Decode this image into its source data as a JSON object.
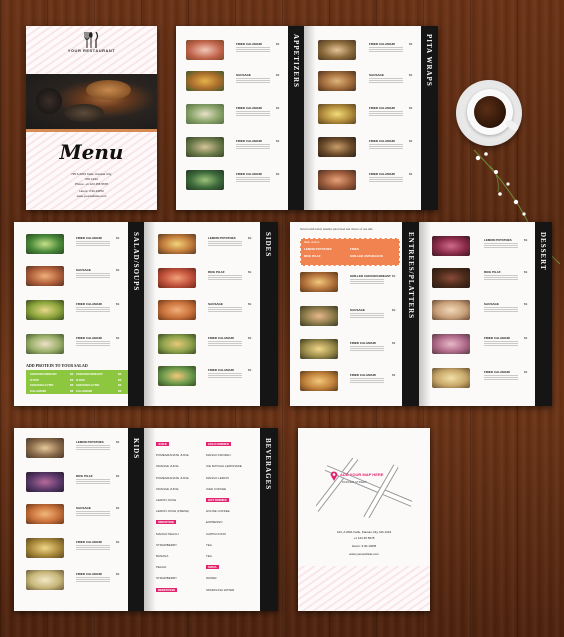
{
  "cover": {
    "brand": "YOUR RESTAURANT",
    "title": "Menu",
    "address_line1": "725 A 2001 Kelle, Kansas City,",
    "address_line2": "MO 1234",
    "phone": "Phone: +1 123 456 5678",
    "hours": "Hours: 3:30-10PM",
    "website": "www.yourwebsite.com"
  },
  "sections": {
    "appetizers": "APPETIZERS",
    "pita_wraps": "PITA WRAPS",
    "salad_soups": "SALAD/SOUPS",
    "sides": "SIDES",
    "entrees_platters": "ENTREES/PLATTERS",
    "dessert": "DESSERT",
    "kids": "KIDS",
    "beverages": "BEVERAGES"
  },
  "items": {
    "fried_calamari": "FRIED CALAMARI",
    "sausage": "SAUSAGE",
    "lemon_potatoes": "LEMON POTATOES",
    "rice_pilaf": "RICE PILAF",
    "grilled_chicken_breast": "GRILLED CHICKEN BREAST",
    "price": "$9"
  },
  "salad_protein": {
    "heading": "ADD PROTEIN TO YOUR SALAD",
    "rows": [
      {
        "left": "CHICKEN BREAST",
        "left_price": "$3",
        "right": "CHICKEN BREAST",
        "right_price": "$3"
      },
      {
        "left": "GYRO",
        "left_price": "$3",
        "right": "GYRO",
        "right_price": "$3"
      },
      {
        "left": "CHICKEN GYRO",
        "left_price": "$3",
        "right": "CHICKEN GYRO",
        "right_price": "$3"
      },
      {
        "left": "CALAMARI",
        "left_price": "$3",
        "right": "CALAMARI",
        "right_price": "$3"
      }
    ]
  },
  "entrees_intro": {
    "note": "Served with salad, tzatziki, pita bread and choice of one side",
    "box_heading": "Side orders",
    "box_items": [
      "LEMON POTATOES",
      "RICE PILAF",
      "FRIES",
      "GRILLED ASPARAGUS"
    ]
  },
  "beverages": {
    "col1": [
      "JUICE",
      "POMEGRANATE JUICE",
      "ORANGE JUICE",
      "POMEGRANATE JUICE",
      "ORANGE JUICE",
      "LEMON JUICE",
      "LEMON JUICE (FRESH)",
      "SMOOTHIE",
      "MANGO PEACH",
      "STRAWBERRY",
      "BANANA",
      "PEACH",
      "STRAWBERRY",
      "DEMITASSE"
    ],
    "col2": [
      "COLD DRINKS",
      "MANGO FROZEN",
      "ICE MATCHA LEMONADE",
      "MANGO LEMON",
      "ICED COFFEE",
      "HOT DRINKS",
      "HOUSE COFFEE",
      "ESPRESSO",
      "CAPPUCCINO",
      "TEA",
      "TEA",
      "SODA",
      "WATER",
      "SPARKLING WATER"
    ]
  },
  "map": {
    "label": "ADD YOUR MAP HERE",
    "street": "PARKER STREET",
    "address": "123, A 2001 Kelle, Kansas City, MA 1234",
    "phone": "+1 123 45 5678",
    "hours": "Hours: 3:30-10PM",
    "website": "www.yourwebsite.com"
  },
  "colors": {
    "spine": "#151515",
    "accent_green": "#8dc63f",
    "accent_orange": "#f0834f",
    "cover_pattern": "#f6d8de"
  }
}
